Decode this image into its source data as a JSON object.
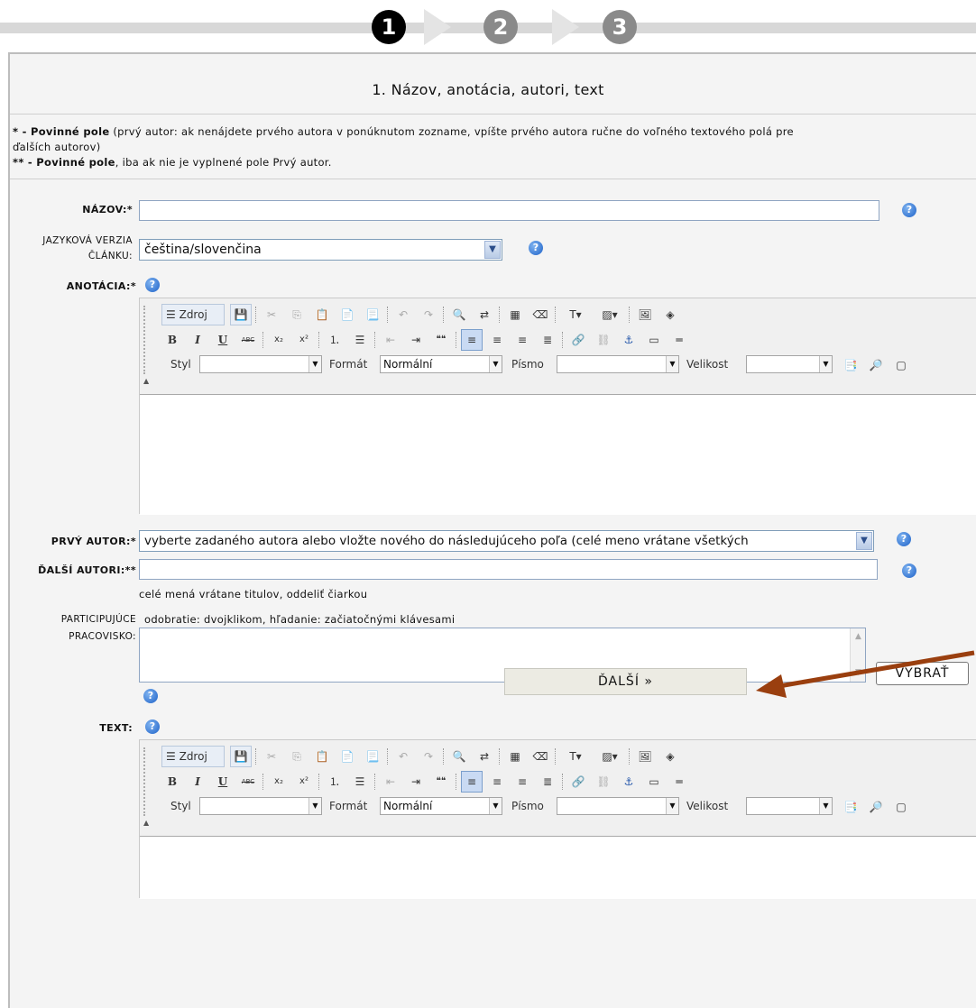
{
  "stepper": {
    "steps": [
      "1",
      "2",
      "3"
    ],
    "active": 1
  },
  "form": {
    "title": "1. Názov, anotácia, autori, text",
    "note1_bold": "* - Povinné pole",
    "note1_rest": " (prvý autor: ak nenájdete prvého autora v ponúknutom zozname, vpíšte prvého autora ručne do voľného textového polá pre",
    "note1_line2": "ďalších autorov)",
    "note2_bold": "** - Povinné pole",
    "note2_rest": ", iba ak nie je vyplnené pole Prvý autor.",
    "fields": {
      "nazov_label": "NÁZOV:*",
      "nazov_value": "",
      "jazyk_label_1": "JAZYKOVÁ VERZIA",
      "jazyk_label_2": "ČLÁNKU:",
      "jazyk_value": "čeština/slovenčina",
      "anotacia_label": "ANOTÁCIA:*",
      "prvy_autor_label": "PRVÝ AUTOR:*",
      "prvy_autor_value": "vyberte zadaného autora alebo vložte nového do následujúceho poľa (celé meno vrátane všetkých",
      "dalsi_autori_label": "ĎALŠÍ AUTORI:**",
      "dalsi_autori_value": "",
      "dalsi_autori_hint": "celé mená vrátane titulov, oddeliť čiarkou",
      "pracovisko_label_1": "PARTICIPUJÚCE",
      "pracovisko_label_2": "PRACOVISKO:",
      "pracovisko_hint": "odobratie: dvojklikom, hľadanie: začiatočnými klávesami",
      "vybrat_button": "VYBRAŤ",
      "text_label": "TEXT:"
    },
    "help_glyph": "?",
    "next_button": "ĎALŠÍ »"
  },
  "editor_toolbar": {
    "source_label": "Zdroj",
    "bold": "B",
    "italic": "I",
    "underline": "U",
    "strike": "ABC",
    "subscript": "x₂",
    "superscript": "x²",
    "quote": "❝❝",
    "style_label": "Styl",
    "style_value": "",
    "format_label": "Formát",
    "format_value": "Normální",
    "font_label": "Písmo",
    "font_value": "",
    "size_label": "Velikost",
    "size_value": ""
  },
  "colors": {
    "annotation_arrow": "#9a3f0f",
    "help": "#1e62c8"
  }
}
